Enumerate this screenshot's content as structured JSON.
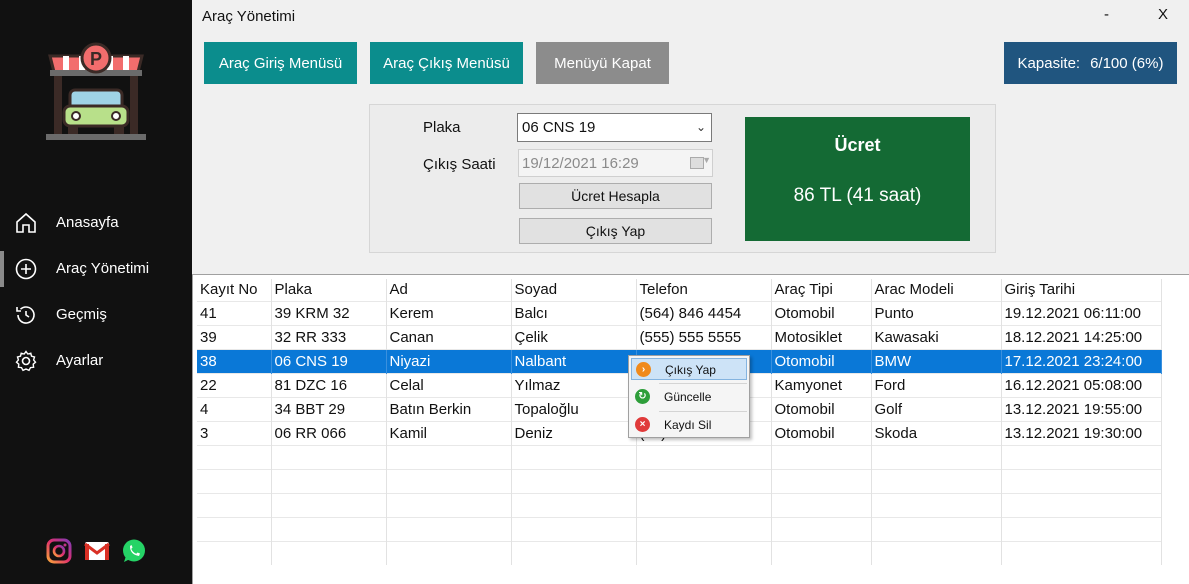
{
  "window": {
    "title": "Araç Yönetimi",
    "minimize": "-",
    "close": "X"
  },
  "sidebar": {
    "items": [
      {
        "label": "Anasayfa",
        "icon": "home-icon"
      },
      {
        "label": "Araç Yönetimi",
        "icon": "plus-circle-icon",
        "active": true
      },
      {
        "label": "Geçmiş",
        "icon": "history-icon"
      },
      {
        "label": "Ayarlar",
        "icon": "gear-icon"
      }
    ],
    "social": [
      "instagram-icon",
      "gmail-icon",
      "whatsapp-icon"
    ]
  },
  "toolbar": {
    "entry_menu": "Araç Giriş Menüsü",
    "exit_menu": "Araç Çıkış Menüsü",
    "close_menu": "Menüyü Kapat",
    "capacity_label": "Kapasite:",
    "capacity_value": "6/100 (6%)"
  },
  "exit_form": {
    "plate_label": "Plaka",
    "plate_value": "06 CNS 19",
    "exit_time_label": "Çıkış Saati",
    "exit_time_value": "19/12/2021 16:29",
    "calculate_button": "Ücret Hesapla",
    "exit_button": "Çıkış Yap"
  },
  "fee": {
    "title": "Ücret",
    "value": "86 TL (41 saat)"
  },
  "table": {
    "columns": [
      "Kayıt No",
      "Plaka",
      "Ad",
      "Soyad",
      "Telefon",
      "Araç Tipi",
      "Arac Modeli",
      "Giriş Tarihi"
    ],
    "rows": [
      [
        "41",
        "39 KRM 32",
        "Kerem",
        "Balcı",
        "(564) 846 4454",
        "Otomobil",
        "Punto",
        "19.12.2021 06:11:00"
      ],
      [
        "39",
        "32 RR 333",
        "Canan",
        "Çelik",
        "(555) 555 5555",
        "Motosiklet",
        "Kawasaki",
        "18.12.2021 14:25:00"
      ],
      [
        "38",
        "06 CNS 19",
        "Niyazi",
        "Nalbant",
        "",
        "Otomobil",
        "BMW",
        "17.12.2021 23:24:00"
      ],
      [
        "22",
        "81 DZC 16",
        "Celal",
        "Yılmaz",
        "",
        "Kamyonet",
        "Ford",
        "16.12.2021 05:08:00"
      ],
      [
        "4",
        "34 BBT 29",
        "Batın Berkin",
        "Topaloğlu",
        "",
        "Otomobil",
        "Golf",
        "13.12.2021 19:55:00"
      ],
      [
        "3",
        "06 RR 066",
        "Kamil",
        "Deniz",
        "(5..) ... 1.54",
        "Otomobil",
        "Skoda",
        "13.12.2021 19:30:00"
      ]
    ],
    "selected_row": 2
  },
  "context_menu": {
    "items": [
      {
        "label": "Çıkış Yap",
        "icon": "arrow-right-icon",
        "color": "#f08a1c"
      },
      {
        "label": "Güncelle",
        "icon": "refresh-icon",
        "color": "#2e9e3a"
      },
      {
        "label": "Kaydı Sil",
        "icon": "delete-icon",
        "color": "#e03a3a"
      }
    ]
  },
  "colors": {
    "sidebar": "#111111",
    "teal": "#0b8d8d",
    "gray_button": "#8c8c8c",
    "capacity": "#20557f",
    "fee": "#146a34",
    "selection": "#0a78d7"
  }
}
